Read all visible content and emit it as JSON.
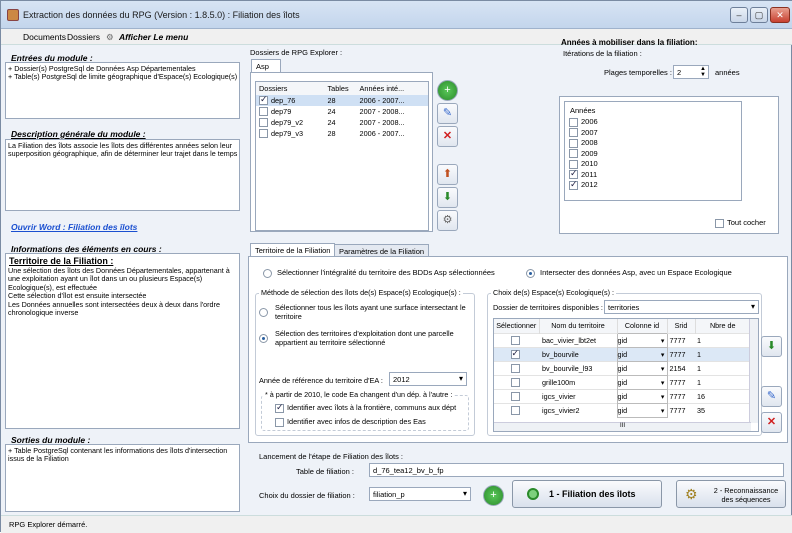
{
  "window": {
    "title": "Extraction des données du RPG (Version : 1.8.5.0) : Filiation des îlots",
    "minimize": "–",
    "maximize": "▢",
    "close": "✕"
  },
  "menu": {
    "documents": "Documents",
    "dossiers": "Dossiers",
    "afficher": "Afficher Le menu"
  },
  "left": {
    "entrees_title": "Entrées du module :",
    "entrees_text": "+ Dossier(s) PostgreSql de Données Asp Départementales\n+ Table(s) PostgreSql de limite géographique d'Espace(s) Ecologique(s)",
    "description_title": "Description générale du module :",
    "description_text": "La Filiation des îlots associe les îlots des différentes années selon leur superposition géographique, afin de déterminer leur trajet dans le temps",
    "word_link": "Ouvrir Word : Filiation des îlots",
    "infos_title": "Informations des éléments en cours :",
    "infos_subtitle": "Territoire de la Filiation :",
    "infos_text": "Une sélection des îlots des Données Départementales, appartenant à une exploitation ayant un îlot dans un ou plusieurs Espace(s) Ecologique(s), est effectuée\nCette sélection d'îlot est ensuite intersectée\nLes Données annuelles sont intersectées deux à deux dans l'ordre chronologique inverse",
    "sorties_title": "Sorties du module :",
    "sorties_text": "+ Table PostgreSql contenant les informations des îlots d'intersection issus de la Filiation"
  },
  "explorer": {
    "label": "Dossiers de RPG Explorer :",
    "tab": "Asp",
    "columns": [
      "Dossiers",
      "Tables",
      "Années inté..."
    ],
    "rows": [
      {
        "name": "dep_76",
        "tables": "28",
        "years": "2006 - 2007...",
        "checked": true
      },
      {
        "name": "dep79",
        "tables": "24",
        "years": "2007 - 2008...",
        "checked": false
      },
      {
        "name": "dep79_v2",
        "tables": "24",
        "years": "2007 - 2008...",
        "checked": false
      },
      {
        "name": "dep79_v3",
        "tables": "28",
        "years": "2006 - 2007...",
        "checked": false
      }
    ]
  },
  "years": {
    "title": "Années à mobiliser dans la filiation:",
    "iterations_label": "Itérations de la filiation :",
    "plages_label": "Plages temporelles :",
    "plages_value": "2",
    "plages_unit": "années",
    "list_header": "Années",
    "list": [
      {
        "year": "2006",
        "checked": false
      },
      {
        "year": "2007",
        "checked": false
      },
      {
        "year": "2008",
        "checked": false
      },
      {
        "year": "2009",
        "checked": false
      },
      {
        "year": "2010",
        "checked": false
      },
      {
        "year": "2011",
        "checked": true
      },
      {
        "year": "2012",
        "checked": true
      }
    ],
    "tout_cocher": "Tout cocher"
  },
  "tabs": {
    "territoire": "Territoire de la Filiation",
    "parametres": "Paramètres de la Filiation"
  },
  "territory": {
    "radio_all": "Sélectionner l'intégralité du territoire des BDDs Asp sélectionnées",
    "radio_intersect": "Intersecter des données Asp, avec un Espace Ecologique",
    "method_label": "Méthode de sélection des îlots de(s) Espace(s) Ecologique(s) :",
    "method_opt1": "Sélectionner tous les îlots ayant une surface intersectant le territoire",
    "method_opt2": "Sélection des territoires d'exploitation dont une parcelle appartient au territoire sélectionné",
    "ref_year_label": "Année de référence du territoire d'EA :",
    "ref_year_value": "2012",
    "note": "* à partir de 2010, le code Ea changent d'un dép. à l'autre :",
    "chk_frontier": "Identifier avec îlots à la frontière, communs aux dépt",
    "chk_desc": "Identifier avec infos de description des Eas",
    "choix_label": "Choix de(s) Espace(s) Ecologique(s) :",
    "dossier_label": "Dossier de territoires disponibles :",
    "dossier_value": "territories",
    "grid_columns": [
      "Sélectionner",
      "Nom du territoire",
      "Colonne id",
      "Srid",
      "Nbre de"
    ],
    "grid_rows": [
      {
        "name": "bac_vivier_lbt2et",
        "col": "gid",
        "srid": "7777",
        "n": "1",
        "checked": false
      },
      {
        "name": "bv_bourvile",
        "col": "gid",
        "srid": "7777",
        "n": "1",
        "checked": true
      },
      {
        "name": "bv_bourvile_l93",
        "col": "gid",
        "srid": "2154",
        "n": "1",
        "checked": false
      },
      {
        "name": "grille100m",
        "col": "gid",
        "srid": "7777",
        "n": "1",
        "checked": false
      },
      {
        "name": "igcs_vivier",
        "col": "gid",
        "srid": "7777",
        "n": "16",
        "checked": false
      },
      {
        "name": "igcs_vivier2",
        "col": "gid",
        "srid": "7777",
        "n": "35",
        "checked": false
      }
    ],
    "scroll_dots": "III"
  },
  "launch": {
    "title": "Lancement de l'étape de Filiation des îlots :",
    "table_label": "Table de filiation :",
    "table_value": "d_76_tea12_bv_b_fp",
    "choix_label": "Choix du dossier de filiation :",
    "choix_value": "filiation_p",
    "run_button": "1 - Filiation des îlots",
    "reco_button": "2 - Reconnaissance des séquences"
  },
  "status": "RPG Explorer démarré."
}
